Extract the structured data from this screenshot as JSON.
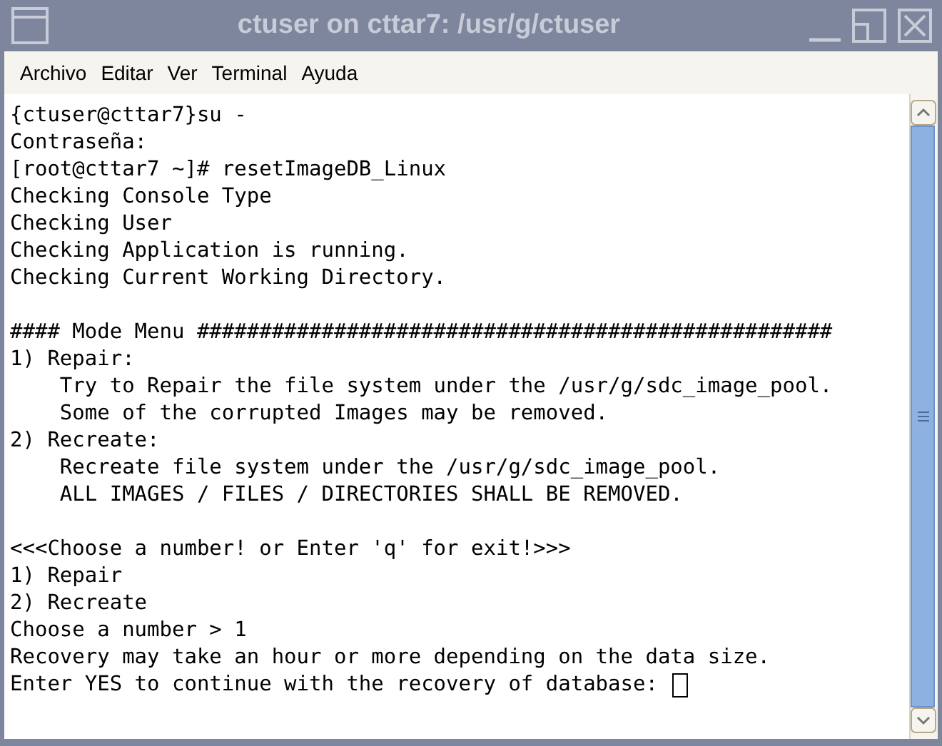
{
  "window": {
    "title": "ctuser on cttar7: /usr/g/ctuser"
  },
  "menu": [
    "Archivo",
    "Editar",
    "Ver",
    "Terminal",
    "Ayuda"
  ],
  "terminal": {
    "blocks": [
      [
        "{ctuser@cttar7}su -",
        "Contraseña:",
        "[root@cttar7 ~]# resetImageDB_Linux",
        "Checking Console Type",
        "Checking User",
        "Checking Application is running.",
        "Checking Current Working Directory."
      ],
      [
        "#### Mode Menu ###################################################",
        "1) Repair:",
        "    Try to Repair the file system under the /usr/g/sdc_image_pool.",
        "    Some of the corrupted Images may be removed.",
        "2) Recreate:",
        "    Recreate file system under the /usr/g/sdc_image_pool.",
        "    ALL IMAGES / FILES / DIRECTORIES SHALL BE REMOVED."
      ],
      [
        "<<<Choose a number! or Enter 'q' for exit!>>>",
        "1) Repair",
        "2) Recreate",
        "Choose a number > 1",
        "Recovery may take an hour or more depending on the data size.",
        "Enter YES to continue with the recovery of database: "
      ]
    ]
  }
}
